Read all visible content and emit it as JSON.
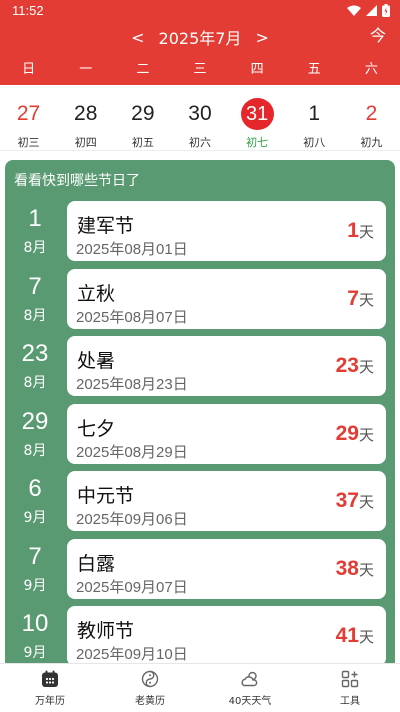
{
  "status": {
    "time": "11:52"
  },
  "header": {
    "prev_arrow": "<",
    "month_title": "2025年7月",
    "next_arrow": ">",
    "today_button": "今",
    "weekdays": [
      "日",
      "一",
      "二",
      "三",
      "四",
      "五",
      "六"
    ]
  },
  "week": [
    {
      "day": "27",
      "lunar": "初三"
    },
    {
      "day": "28",
      "lunar": "初四"
    },
    {
      "day": "29",
      "lunar": "初五"
    },
    {
      "day": "30",
      "lunar": "初六"
    },
    {
      "day": "31",
      "lunar": "初七"
    },
    {
      "day": "1",
      "lunar": "初八"
    },
    {
      "day": "2",
      "lunar": "初九"
    }
  ],
  "festivals": {
    "title": "看看快到哪些节日了",
    "items": [
      {
        "day": "1",
        "month": "8月",
        "name": "建军节",
        "date": "2025年08月01日",
        "days": "1",
        "unit": "天"
      },
      {
        "day": "7",
        "month": "8月",
        "name": "立秋",
        "date": "2025年08月07日",
        "days": "7",
        "unit": "天"
      },
      {
        "day": "23",
        "month": "8月",
        "name": "处暑",
        "date": "2025年08月23日",
        "days": "23",
        "unit": "天"
      },
      {
        "day": "29",
        "month": "8月",
        "name": "七夕",
        "date": "2025年08月29日",
        "days": "29",
        "unit": "天"
      },
      {
        "day": "6",
        "month": "9月",
        "name": "中元节",
        "date": "2025年09月06日",
        "days": "37",
        "unit": "天"
      },
      {
        "day": "7",
        "month": "9月",
        "name": "白露",
        "date": "2025年09月07日",
        "days": "38",
        "unit": "天"
      },
      {
        "day": "10",
        "month": "9月",
        "name": "教师节",
        "date": "2025年09月10日",
        "days": "41",
        "unit": "天"
      }
    ]
  },
  "tabs": [
    "万年历",
    "老黄历",
    "40天天气",
    "工具"
  ],
  "colors": {
    "accent": "#e23c34",
    "panel": "#5a9a72",
    "lunar_today": "#2f9e44"
  }
}
